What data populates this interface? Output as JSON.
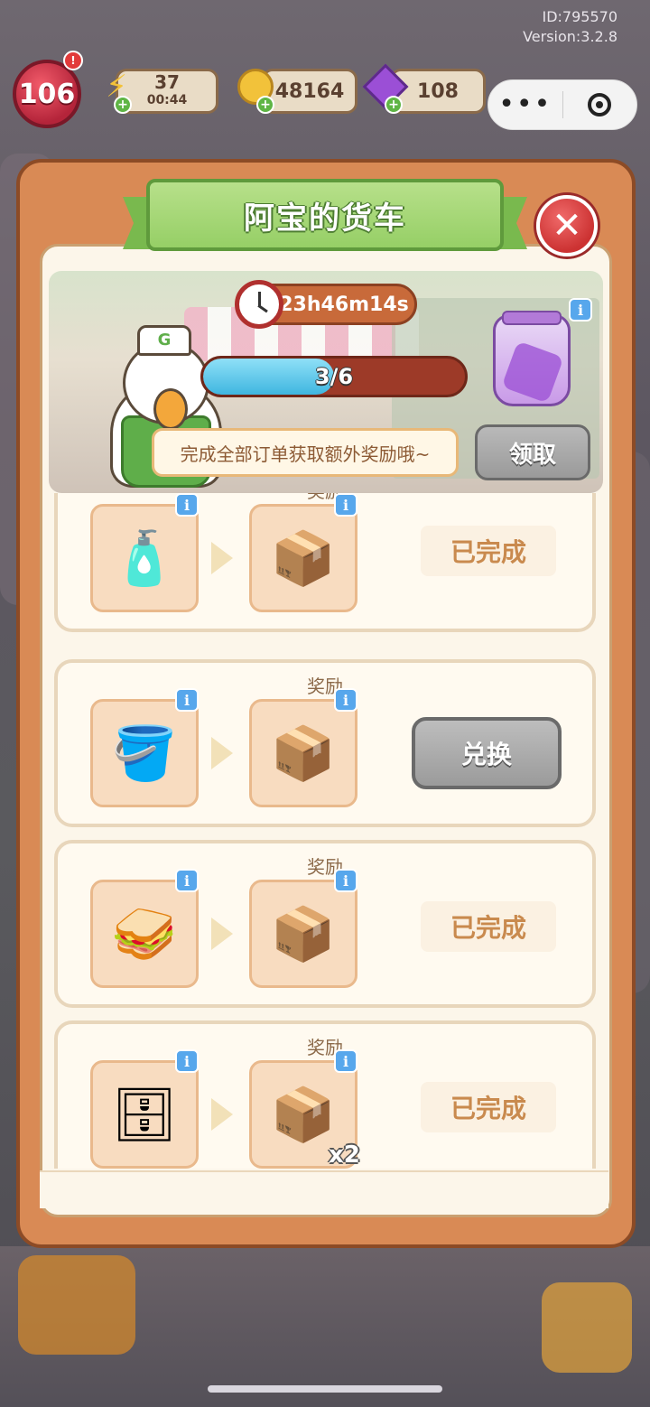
{
  "system": {
    "id": "ID:795570",
    "version": "Version:3.2.8"
  },
  "hud": {
    "level": "106",
    "level_alert": "!",
    "energy": {
      "value": "37",
      "timer": "00:44"
    },
    "coins": "48164",
    "gems": "108",
    "plus": "+"
  },
  "capsule": {
    "more": "•••"
  },
  "modal": {
    "title": "阿宝的货车",
    "close": "✕",
    "timer": "23h46m14s",
    "progress": {
      "text": "3/6",
      "fraction": 0.5
    },
    "hint": "完成全部订单获取额外奖励哦~",
    "claim_label": "领取",
    "duck_cap": "G"
  },
  "info_glyph": "i",
  "orders": [
    {
      "label": "奖励",
      "give_icon": "water-bottle-icon",
      "give_glyph": "🧴",
      "reward_icon": "box-dumbbell-icon",
      "reward_glyph": "📦",
      "status": "已完成"
    },
    {
      "label": "奖励",
      "give_icon": "ice-bucket-icon",
      "give_glyph": "🪣",
      "reward_icon": "box-wallet-icon",
      "reward_glyph": "📦",
      "action": "兑换"
    },
    {
      "label": "奖励",
      "give_icon": "sandwich-icon",
      "give_glyph": "🥪",
      "reward_icon": "box-gloves-icon",
      "reward_glyph": "📦",
      "status": "已完成"
    },
    {
      "label": "奖励",
      "give_icon": "cabinet-icon",
      "give_glyph": "🗄",
      "reward_icon": "box-banana-icon",
      "reward_glyph": "📦",
      "quantity": "x2",
      "status": "已完成"
    }
  ],
  "colors": {
    "modal": "#d98a55",
    "panel": "#fcf6ea",
    "title": "#96cf66",
    "close": "#cc3232",
    "progress": "#3fb6e0",
    "done": "#c98a4e"
  }
}
